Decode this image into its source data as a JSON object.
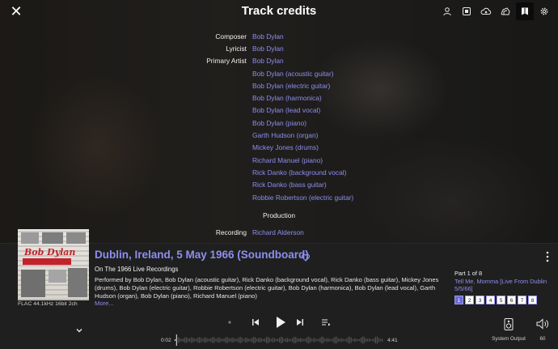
{
  "header": {
    "title": "Track credits",
    "close_icon": "close-icon",
    "icons": [
      "user-icon",
      "tv-icon",
      "cloud-icon",
      "stack-icon",
      "book-icon",
      "gear-icon"
    ]
  },
  "credits": [
    {
      "role": "Composer",
      "person": "Bob Dylan"
    },
    {
      "role": "Lyricist",
      "person": "Bob Dylan"
    },
    {
      "role": "Primary Artist",
      "person": "Bob Dylan"
    },
    {
      "role": "",
      "person": "Bob Dylan (acoustic guitar)"
    },
    {
      "role": "",
      "person": "Bob Dylan (electric guitar)"
    },
    {
      "role": "",
      "person": "Bob Dylan (harmonica)"
    },
    {
      "role": "",
      "person": "Bob Dylan (lead vocal)"
    },
    {
      "role": "",
      "person": "Bob Dylan (piano)"
    },
    {
      "role": "",
      "person": "Garth Hudson (organ)"
    },
    {
      "role": "",
      "person": "Mickey Jones (drums)"
    },
    {
      "role": "",
      "person": "Richard Manuel (piano)"
    },
    {
      "role": "",
      "person": "Rick Danko (background vocal)"
    },
    {
      "role": "",
      "person": "Rick Danko (bass guitar)"
    },
    {
      "role": "",
      "person": "Robbie Robertson (electric guitar)"
    }
  ],
  "production": {
    "heading": "Production",
    "rows": [
      {
        "role": "Recording",
        "person": "Richard Alderson"
      }
    ]
  },
  "player": {
    "cover_text": "Bob Dylan",
    "format": "FLAC 44.1kHz 16bit 2ch",
    "track_title": "Dublin, Ireland, 5 May 1966 (Soundboard)",
    "album": "On The 1966 Live Recordings",
    "performed": "Performed by Bob Dylan, Bob Dylan (acoustic guitar), Rick Danko (background vocal), Rick Danko (bass guitar), Mickey Jones (drums), Bob Dylan (electric guitar), Robbie Robertson (electric guitar), Bob Dylan (harmonica), Bob Dylan (lead vocal), Garth Hudson (organ), Bob Dylan (piano), Richard Manuel (piano)",
    "more": "More...",
    "part_of": "Part 1 of 8",
    "next_track": "Tell Me, Momma [Live From Dublin 5/5/66]",
    "pages": [
      "1",
      "2",
      "3",
      "4",
      "5",
      "6",
      "7",
      "8"
    ],
    "active_page": "1",
    "time_elapsed": "0:02",
    "time_total": "4:41",
    "progress": 0.007,
    "output_label": "System Output",
    "volume": "60",
    "accent_color": "#8e8ef0"
  }
}
